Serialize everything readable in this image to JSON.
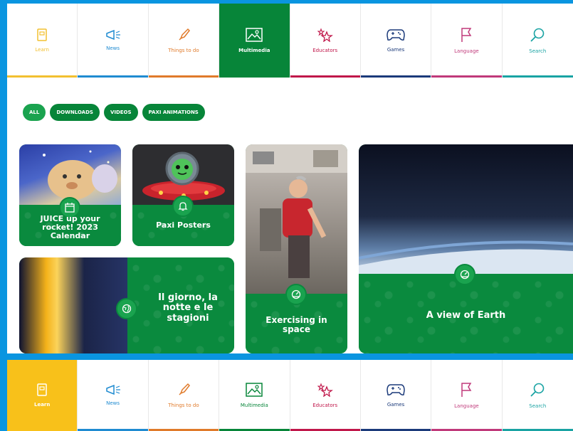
{
  "nav": {
    "items": [
      {
        "label": "Learn",
        "icon": "book-icon",
        "color": "#f2c030"
      },
      {
        "label": "News",
        "icon": "megaphone-icon",
        "color": "#1f8bd1"
      },
      {
        "label": "Things to do",
        "icon": "rocket-icon",
        "color": "#e07a2a"
      },
      {
        "label": "Multimedia",
        "icon": "image-icon",
        "color": "#078539"
      },
      {
        "label": "Educators",
        "icon": "stars-icon",
        "color": "#c0174a"
      },
      {
        "label": "Games",
        "icon": "gamepad-icon",
        "color": "#1b3a7a"
      },
      {
        "label": "Language",
        "icon": "flag-icon",
        "color": "#c0397a"
      },
      {
        "label": "Search",
        "icon": "search-icon",
        "color": "#19a3a3"
      }
    ]
  },
  "filters": [
    "ALL",
    "DOWNLOADS",
    "VIDEOS",
    "PAXI ANIMATIONS"
  ],
  "cards": {
    "juice": "JUICE up your rocket! 2023 Calendar",
    "paxi": "Paxi Posters",
    "exercise": "Exercising in space",
    "earth": "A view of Earth",
    "giorno": "Il giorno, la notte e le stagioni"
  },
  "bottom_nav": {
    "items": [
      "Learn",
      "News",
      "Things to do",
      "Multimedia",
      "Educators",
      "Games",
      "Language",
      "Search"
    ]
  }
}
